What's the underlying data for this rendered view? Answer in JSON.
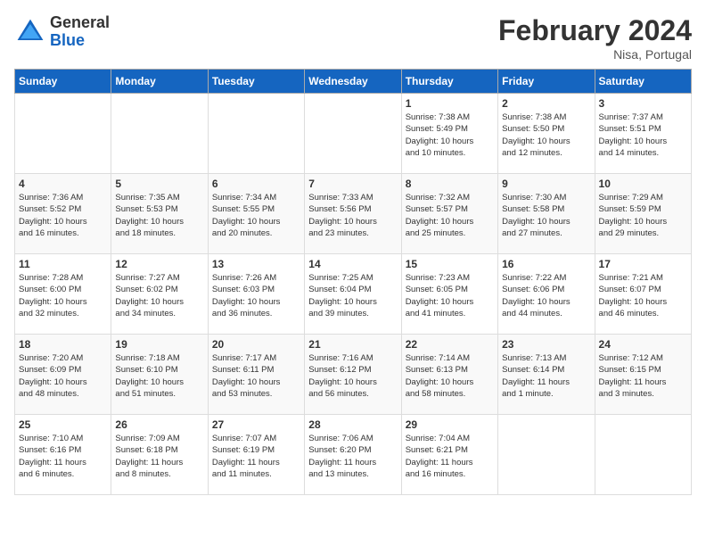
{
  "logo": {
    "general": "General",
    "blue": "Blue"
  },
  "title": "February 2024",
  "subtitle": "Nisa, Portugal",
  "days_header": [
    "Sunday",
    "Monday",
    "Tuesday",
    "Wednesday",
    "Thursday",
    "Friday",
    "Saturday"
  ],
  "weeks": [
    [
      {
        "num": "",
        "info": ""
      },
      {
        "num": "",
        "info": ""
      },
      {
        "num": "",
        "info": ""
      },
      {
        "num": "",
        "info": ""
      },
      {
        "num": "1",
        "info": "Sunrise: 7:38 AM\nSunset: 5:49 PM\nDaylight: 10 hours\nand 10 minutes."
      },
      {
        "num": "2",
        "info": "Sunrise: 7:38 AM\nSunset: 5:50 PM\nDaylight: 10 hours\nand 12 minutes."
      },
      {
        "num": "3",
        "info": "Sunrise: 7:37 AM\nSunset: 5:51 PM\nDaylight: 10 hours\nand 14 minutes."
      }
    ],
    [
      {
        "num": "4",
        "info": "Sunrise: 7:36 AM\nSunset: 5:52 PM\nDaylight: 10 hours\nand 16 minutes."
      },
      {
        "num": "5",
        "info": "Sunrise: 7:35 AM\nSunset: 5:53 PM\nDaylight: 10 hours\nand 18 minutes."
      },
      {
        "num": "6",
        "info": "Sunrise: 7:34 AM\nSunset: 5:55 PM\nDaylight: 10 hours\nand 20 minutes."
      },
      {
        "num": "7",
        "info": "Sunrise: 7:33 AM\nSunset: 5:56 PM\nDaylight: 10 hours\nand 23 minutes."
      },
      {
        "num": "8",
        "info": "Sunrise: 7:32 AM\nSunset: 5:57 PM\nDaylight: 10 hours\nand 25 minutes."
      },
      {
        "num": "9",
        "info": "Sunrise: 7:30 AM\nSunset: 5:58 PM\nDaylight: 10 hours\nand 27 minutes."
      },
      {
        "num": "10",
        "info": "Sunrise: 7:29 AM\nSunset: 5:59 PM\nDaylight: 10 hours\nand 29 minutes."
      }
    ],
    [
      {
        "num": "11",
        "info": "Sunrise: 7:28 AM\nSunset: 6:00 PM\nDaylight: 10 hours\nand 32 minutes."
      },
      {
        "num": "12",
        "info": "Sunrise: 7:27 AM\nSunset: 6:02 PM\nDaylight: 10 hours\nand 34 minutes."
      },
      {
        "num": "13",
        "info": "Sunrise: 7:26 AM\nSunset: 6:03 PM\nDaylight: 10 hours\nand 36 minutes."
      },
      {
        "num": "14",
        "info": "Sunrise: 7:25 AM\nSunset: 6:04 PM\nDaylight: 10 hours\nand 39 minutes."
      },
      {
        "num": "15",
        "info": "Sunrise: 7:23 AM\nSunset: 6:05 PM\nDaylight: 10 hours\nand 41 minutes."
      },
      {
        "num": "16",
        "info": "Sunrise: 7:22 AM\nSunset: 6:06 PM\nDaylight: 10 hours\nand 44 minutes."
      },
      {
        "num": "17",
        "info": "Sunrise: 7:21 AM\nSunset: 6:07 PM\nDaylight: 10 hours\nand 46 minutes."
      }
    ],
    [
      {
        "num": "18",
        "info": "Sunrise: 7:20 AM\nSunset: 6:09 PM\nDaylight: 10 hours\nand 48 minutes."
      },
      {
        "num": "19",
        "info": "Sunrise: 7:18 AM\nSunset: 6:10 PM\nDaylight: 10 hours\nand 51 minutes."
      },
      {
        "num": "20",
        "info": "Sunrise: 7:17 AM\nSunset: 6:11 PM\nDaylight: 10 hours\nand 53 minutes."
      },
      {
        "num": "21",
        "info": "Sunrise: 7:16 AM\nSunset: 6:12 PM\nDaylight: 10 hours\nand 56 minutes."
      },
      {
        "num": "22",
        "info": "Sunrise: 7:14 AM\nSunset: 6:13 PM\nDaylight: 10 hours\nand 58 minutes."
      },
      {
        "num": "23",
        "info": "Sunrise: 7:13 AM\nSunset: 6:14 PM\nDaylight: 11 hours\nand 1 minute."
      },
      {
        "num": "24",
        "info": "Sunrise: 7:12 AM\nSunset: 6:15 PM\nDaylight: 11 hours\nand 3 minutes."
      }
    ],
    [
      {
        "num": "25",
        "info": "Sunrise: 7:10 AM\nSunset: 6:16 PM\nDaylight: 11 hours\nand 6 minutes."
      },
      {
        "num": "26",
        "info": "Sunrise: 7:09 AM\nSunset: 6:18 PM\nDaylight: 11 hours\nand 8 minutes."
      },
      {
        "num": "27",
        "info": "Sunrise: 7:07 AM\nSunset: 6:19 PM\nDaylight: 11 hours\nand 11 minutes."
      },
      {
        "num": "28",
        "info": "Sunrise: 7:06 AM\nSunset: 6:20 PM\nDaylight: 11 hours\nand 13 minutes."
      },
      {
        "num": "29",
        "info": "Sunrise: 7:04 AM\nSunset: 6:21 PM\nDaylight: 11 hours\nand 16 minutes."
      },
      {
        "num": "",
        "info": ""
      },
      {
        "num": "",
        "info": ""
      }
    ]
  ]
}
